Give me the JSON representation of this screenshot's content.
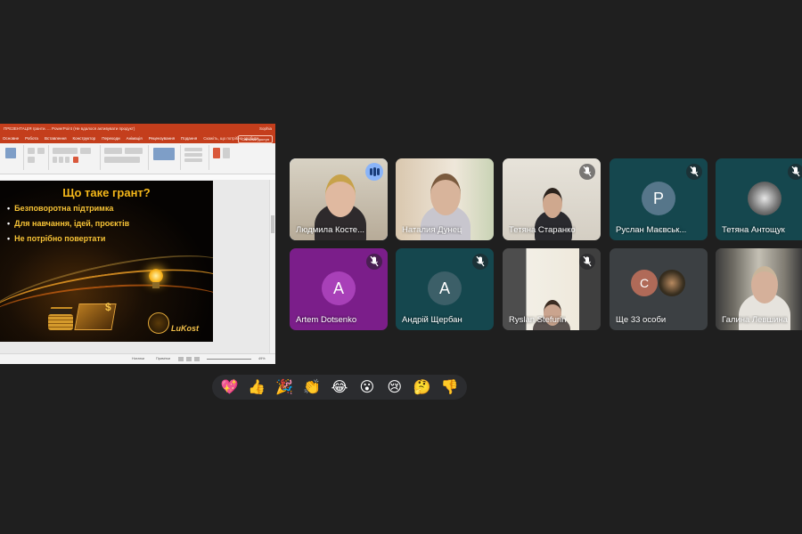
{
  "presentation": {
    "title_bar": "ПРЕЗЕНТАЦІЯ гранти. ... PowerPoint (Не вдалося активувати продукт)",
    "title_right": "Sophia",
    "menu": [
      "Основне",
      "Робота",
      "Вставлення",
      "Конструктор",
      "Переходи",
      "Анімація",
      "Рецензування",
      "Подання"
    ],
    "tell_me": "Скажіть, що потрібно зробити",
    "share_label": "Спільний доступ",
    "slide": {
      "title": "Що таке грант?",
      "bullets": [
        "Безповоротна підтримка",
        "Для навчання, ідей, проєктів",
        "Не потрібно повертати"
      ],
      "logo_name": "LuKost"
    },
    "status": {
      "notes": "Нотатки",
      "comments": "Примітки",
      "zoom": "49%"
    }
  },
  "participants": [
    {
      "name": "Людмила Косте...",
      "type": "video",
      "speaking": true
    },
    {
      "name": "Наталия Дунец",
      "type": "video",
      "muted": false
    },
    {
      "name": "Тетяна Старанко",
      "type": "video",
      "muted": true
    },
    {
      "name": "Руслан Маєвськ...",
      "type": "avatar",
      "initial": "Р",
      "avatar_color": "#56768a",
      "muted": true
    },
    {
      "name": "Тетяна Антощук",
      "type": "photo",
      "muted": true
    },
    {
      "name": "Artem Dotsenko",
      "type": "avatar",
      "initial": "A",
      "avatar_color": "#a840b8",
      "muted": true
    },
    {
      "name": "Андрій Щербан",
      "type": "avatar",
      "initial": "A",
      "avatar_color": "#3c5f68",
      "muted": true
    },
    {
      "name": "Ryslan Stefurin",
      "type": "video",
      "muted": true
    },
    {
      "name": "Ще 33 особи",
      "type": "more",
      "initial": "C",
      "avatar_color": "#b06a58"
    },
    {
      "name": "Галина Левшина",
      "type": "video",
      "muted": false
    }
  ],
  "colors": {
    "tile_bg": "#3c4043",
    "teal_tile": "#15474e",
    "purple_tile": "#7b1e8a",
    "active_border": "#8ab4f8"
  },
  "reactions": [
    "💖",
    "👍",
    "🎉",
    "👏",
    "😂",
    "😮",
    "😢",
    "🤔",
    "👎"
  ]
}
